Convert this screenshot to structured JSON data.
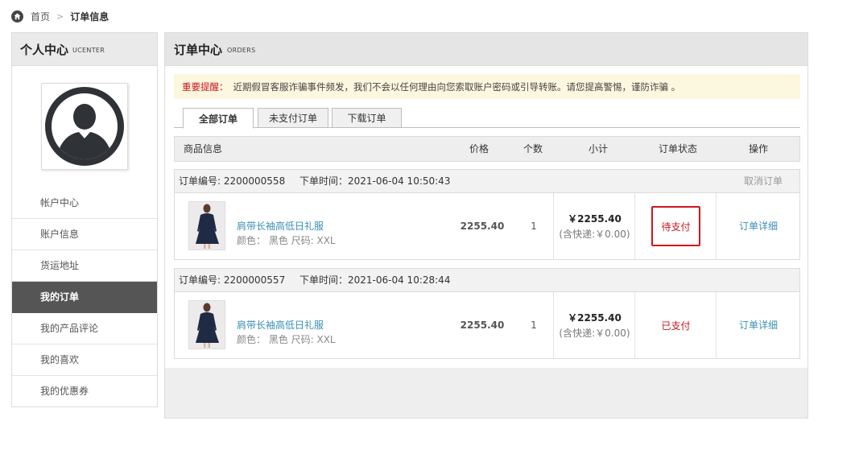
{
  "breadcrumb": {
    "home": "首页",
    "separator": ">",
    "current": "订单信息"
  },
  "sidebar": {
    "title": "个人中心",
    "subtitle": "UCENTER",
    "items": [
      {
        "label": "帐户中心",
        "active": false
      },
      {
        "label": "账户信息",
        "active": false
      },
      {
        "label": "货运地址",
        "active": false
      },
      {
        "label": "我的订单",
        "active": true
      },
      {
        "label": "我的产品评论",
        "active": false
      },
      {
        "label": "我的喜欢",
        "active": false
      },
      {
        "label": "我的优惠券",
        "active": false
      }
    ]
  },
  "main": {
    "title": "订单中心",
    "subtitle": "ORDERS",
    "notice": {
      "label": "重要提醒：",
      "text": "近期假冒客服诈骗事件频发，我们不会以任何理由向您索取账户密码或引导转账。请您提高警惕，谨防诈骗 。"
    },
    "tabs": [
      {
        "label": "全部订单",
        "active": true
      },
      {
        "label": "未支付订单",
        "active": false
      },
      {
        "label": "下载订单",
        "active": false
      }
    ],
    "columns": {
      "product": "商品信息",
      "price": "价格",
      "qty": "个数",
      "subtotal": "小计",
      "status": "订单状态",
      "action": "操作"
    },
    "orders": [
      {
        "number_label": "订单编号: 2200000558",
        "time_label": "下单时间：2021-06-04 10:50:43",
        "cancel": "取消订单",
        "product_name": "肩带长袖高低日礼服",
        "product_spec": "颜色：  黑色   尺码:  XXL",
        "price": "2255.40",
        "qty": "1",
        "subtotal": "￥2255.40",
        "shipping": "(含快递:￥0.00)",
        "status": "待支付",
        "action": "订单详细"
      },
      {
        "number_label": "订单编号: 2200000557",
        "time_label": "下单时间：2021-06-04 10:28:44",
        "cancel": "",
        "product_name": "肩带长袖高低日礼服",
        "product_spec": "颜色：  黑色   尺码:  XXL",
        "price": "2255.40",
        "qty": "1",
        "subtotal": "￥2255.40",
        "shipping": "(含快递:￥0.00)",
        "status": "已支付",
        "action": "订单详细"
      }
    ]
  },
  "colors": {
    "accent_red": "#c8161d",
    "link_blue": "#3a8fb7",
    "active_nav_bg": "#555555",
    "notice_bg": "#fcf7df"
  },
  "icons": {
    "home": "home-icon",
    "avatar": "user-avatar-icon"
  }
}
